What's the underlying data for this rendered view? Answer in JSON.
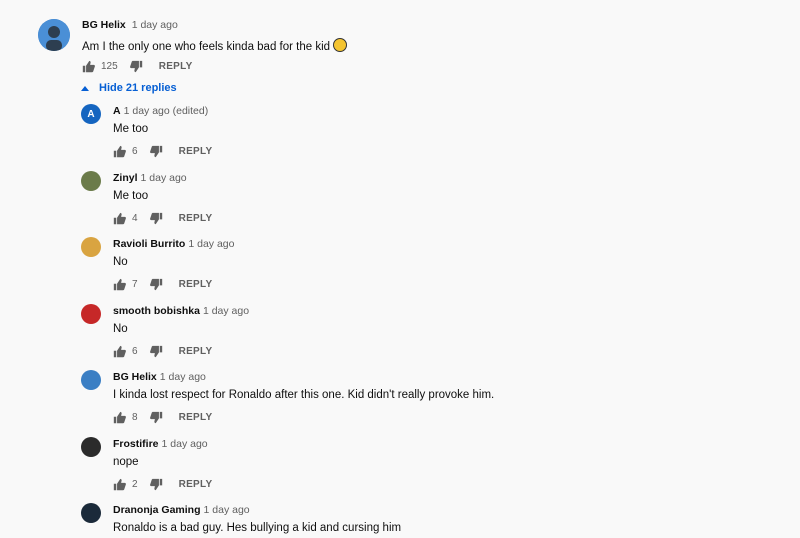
{
  "thread": {
    "author": "BG Helix",
    "time": "1 day ago",
    "text": "Am I the only one who feels kinda bad for the kid",
    "likes": "125",
    "reply_label": "REPLY",
    "avatar_color": "#3b7fc4"
  },
  "hide_replies_label": "Hide 21 replies",
  "replies": [
    {
      "author": "A",
      "time": "1 day ago (edited)",
      "text": "Me too",
      "likes": "6",
      "reply_label": "REPLY",
      "avatar_letter": "A",
      "avatar_color": "#1565c0"
    },
    {
      "author": "Zinyl",
      "time": "1 day ago",
      "text": "Me too",
      "likes": "4",
      "reply_label": "REPLY",
      "avatar_color": "#6b7b4a"
    },
    {
      "author": "Ravioli Burrito",
      "time": "1 day ago",
      "text": "No",
      "likes": "7",
      "reply_label": "REPLY",
      "avatar_color": "#d9a441"
    },
    {
      "author": "smooth bobishka",
      "time": "1 day ago",
      "text": "No",
      "likes": "6",
      "reply_label": "REPLY",
      "avatar_color": "#c62828"
    },
    {
      "author": "BG Helix",
      "time": "1 day ago",
      "text": "I kinda lost respect for Ronaldo after this one. Kid didn't really provoke him.",
      "likes": "8",
      "reply_label": "REPLY",
      "avatar_color": "#3b7fc4"
    },
    {
      "author": "Frostifire",
      "time": "1 day ago",
      "text": "nope",
      "likes": "2",
      "reply_label": "REPLY",
      "avatar_color": "#2b2b2b"
    },
    {
      "author": "Dranonja Gaming",
      "time": "1 day ago",
      "text": "Ronaldo is a bad guy. Hes bullying a kid and cursing him",
      "likes": "",
      "reply_label": "",
      "avatar_color": "#1b2a3a"
    }
  ]
}
